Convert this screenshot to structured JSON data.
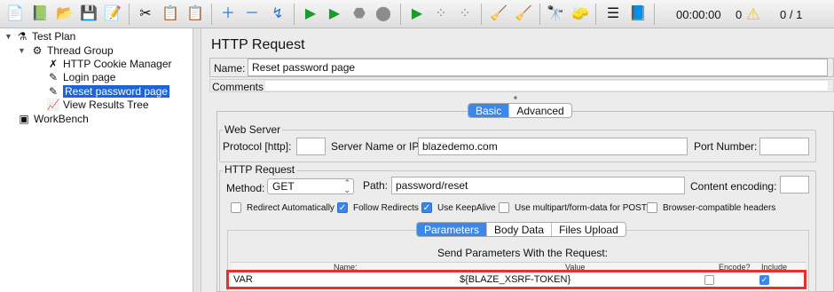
{
  "toolbar": {
    "icons": [
      "new-icon",
      "templates-icon",
      "open-icon",
      "save-icon",
      "save-as-icon",
      "cut-icon",
      "copy-icon",
      "paste-icon",
      "expand-icon",
      "collapse-icon",
      "toggle-icon",
      "start-icon",
      "start-no-pauses-icon",
      "stop-icon",
      "shutdown-icon",
      "remote-start-icon",
      "remote-stop-icon",
      "remote-exit-icon",
      "clear-icon",
      "clear-all-icon",
      "search-icon",
      "reset-search-icon",
      "function-helper-icon",
      "help-icon"
    ],
    "timer": "00:00:00",
    "warnings": "0",
    "threads": "0 / 1",
    "warning_color": "#f5c400"
  },
  "tree": {
    "items": [
      {
        "label": "Test Plan",
        "icon": "test-plan-icon"
      },
      {
        "label": "Thread Group",
        "icon": "thread-group-icon"
      },
      {
        "label": "HTTP Cookie Manager",
        "icon": "cookie-manager-icon"
      },
      {
        "label": "Login page",
        "icon": "sampler-icon"
      },
      {
        "label": "Reset password page",
        "icon": "sampler-icon"
      },
      {
        "label": "View Results Tree",
        "icon": "listener-icon"
      },
      {
        "label": "WorkBench",
        "icon": "workbench-icon"
      }
    ],
    "selected_color": "#1e64d2"
  },
  "panel": {
    "title": "HTTP Request",
    "name_label": "Name:",
    "name_value": "Reset password page",
    "comments_label": "Comments:",
    "tabs": [
      "Basic",
      "Advanced"
    ],
    "web_server": {
      "legend": "Web Server",
      "protocol_label": "Protocol [http]:",
      "protocol_value": "",
      "server_label": "Server Name or IP:",
      "server_value": "blazedemo.com",
      "port_label": "Port Number:",
      "port_value": ""
    },
    "http_request": {
      "legend": "HTTP Request",
      "method_label": "Method:",
      "method_value": "GET",
      "path_label": "Path:",
      "path_value": "password/reset",
      "encoding_label": "Content encoding:",
      "encoding_value": "",
      "options": [
        {
          "label": "Redirect Automatically",
          "checked": false
        },
        {
          "label": "Follow Redirects",
          "checked": true
        },
        {
          "label": "Use KeepAlive",
          "checked": true
        },
        {
          "label": "Use multipart/form-data for POST",
          "checked": false
        },
        {
          "label": "Browser-compatible headers",
          "checked": false
        }
      ]
    },
    "sub_tabs": [
      "Parameters",
      "Body Data",
      "Files Upload"
    ],
    "params_title": "Send Parameters With the Request:",
    "columns": [
      "Name:",
      "Value",
      "Encode?",
      "Include Equals?"
    ],
    "rows": [
      {
        "name": "VAR",
        "value": "${BLAZE_XSRF-TOKEN}",
        "encode": false,
        "include_equals": true
      }
    ],
    "accent_color": "#3d87e6",
    "highlight_color": "#e8302c"
  }
}
